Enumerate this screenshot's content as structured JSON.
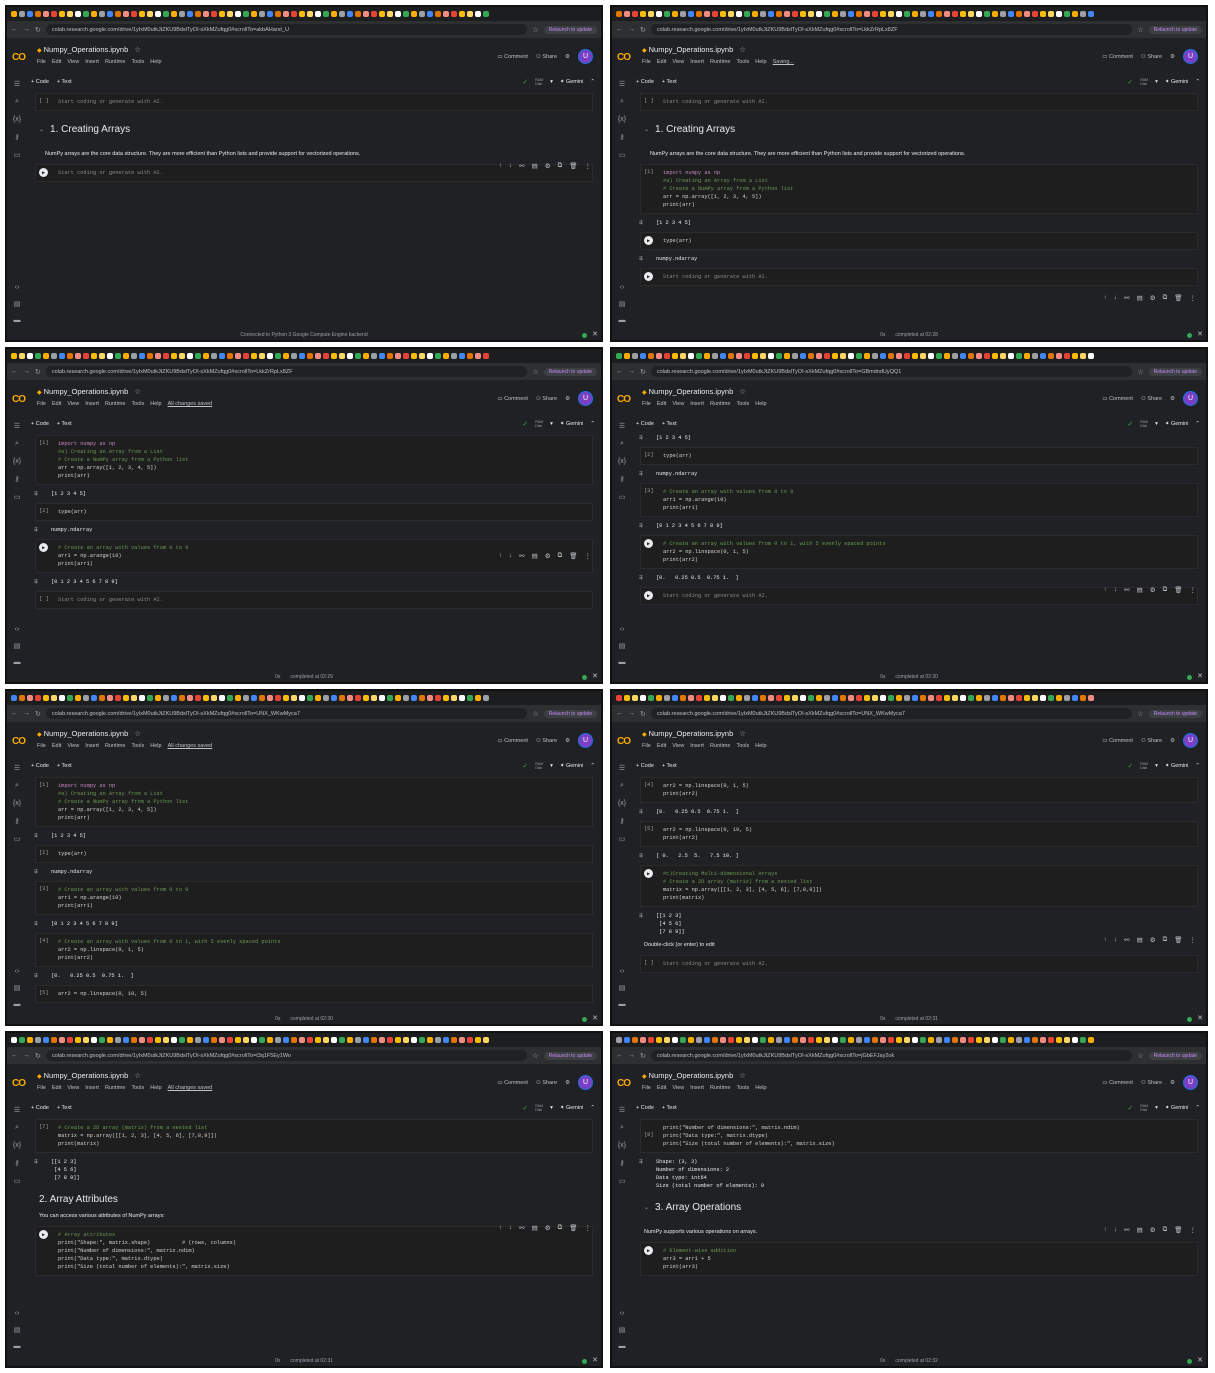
{
  "browser": {
    "relaunch": "Relaunch to update",
    "urls": [
      "colab.research.google.com/drive/1yIxM0utkJtZKU9BdslTyOI-sXkMZufqg0#scrollTo=akbAHarst_U",
      "colab.research.google.com/drive/1yIxM0utkJtZKU9BdslTyOI-sXkMZufqg0#scrollTo=LkkZrRpLx8ZF",
      "colab.research.google.com/drive/1yIxM0utkJtZKU9BdslTyOI-sXkMZufqg0#scrollTo=LkkZrRpLx8ZF",
      "colab.research.google.com/drive/1yIxM0utkJtZKU9BdslTyOI-sXkMZufqg0#scrollTo=GBmdndUyQQ1",
      "colab.research.google.com/drive/1yIxM0utkJtZKU9BdslTyOI-sXkMZufqg0#scrollTo=UNX_WKwMyca7",
      "colab.research.google.com/drive/1yIxM0utkJtZKU9BdslTyOI-sXkMZufqg0#scrollTo=UNX_WKwMyca7",
      "colab.research.google.com/drive/1yIxM0utkJtZKU9BdslTyOI-sXkMZufqg0#scrollTo=t3q1F5Ey1Wo",
      "colab.research.google.com/drive/1yIxM0utkJtZKU9BdslTyOI-sXkMZufqg0#scrollTo=jGbEFJay2ok"
    ]
  },
  "notebook": {
    "title": "Numpy_Operations.ipynb",
    "menu": [
      "File",
      "Edit",
      "View",
      "Insert",
      "Runtime",
      "Tools",
      "Help"
    ],
    "saving": "Saving...",
    "all_saved": "All changes saved",
    "comment": "Comment",
    "share": "Share",
    "avatar": "U",
    "add_code": "+ Code",
    "add_text": "+ Text",
    "ram": "RAM",
    "disk": "Disk",
    "gemini": "✦ Gemini",
    "placeholder": "Start coding or generate with AI."
  },
  "panel1": {
    "heading": "1. Creating Arrays",
    "bullet": "NumPy arrays are the core data structure. They are more efficient than Python lists and provide support for vectorized operations.",
    "status": "Connected to Python 3 Google Compute Engine backend"
  },
  "panel2": {
    "heading": "1. Creating Arrays",
    "bullet": "NumPy arrays are the core data structure. They are more efficient than Python lists and provide support for vectorized operations.",
    "c1_prompt": "[1]",
    "c1_l1": "import numpy as np",
    "c1_l2": "#a) Creating an Array from a List",
    "c1_l3": "# Create a NumPy array from a Python list",
    "c1_l4": "arr = np.array([1, 2, 3, 4, 5])",
    "c1_l5": "print(arr)",
    "o1": "[1 2 3 4 5]",
    "c2_l1": "type(arr)",
    "o2": "numpy.ndarray",
    "status_time": "0s",
    "status": "completed at 02:28"
  },
  "panel3": {
    "c1_prompt": "[1]",
    "c1_l1": "import numpy as np",
    "c1_l2": "#a) Creating an Array from a List",
    "c1_l3": "# Create a NumPy array from a Python list",
    "c1_l4": "arr = np.array([1, 2, 3, 4, 5])",
    "c1_l5": "print(arr)",
    "o1": "[1 2 3 4 5]",
    "c2_prompt": "[2]",
    "c2_l1": "type(arr)",
    "o2": "numpy.ndarray",
    "c3_l1": "# Create an array with values from 0 to 9",
    "c3_l2": "arr1 = np.arange(10)",
    "c3_l3": "print(arr1)",
    "o3": "[0 1 2 3 4 5 6 7 8 9]",
    "status_time": "0s",
    "status": "completed at 02:29"
  },
  "panel4": {
    "o1": "[1 2 3 4 5]",
    "c2_prompt": "[2]",
    "c2_l1": "type(arr)",
    "o2": "numpy.ndarray",
    "c3_prompt": "[3]",
    "c3_l1": "# Create an array with values from 0 to 9",
    "c3_l2": "arr1 = np.arange(10)",
    "c3_l3": "print(arr1)",
    "o3": "[0 1 2 3 4 5 6 7 8 9]",
    "c4_l1": "# Create an array with values from 0 to 1, with 5 evenly spaced points",
    "c4_l2": "arr2 = np.linspace(0, 1, 5)",
    "c4_l3": "print(arr2)",
    "o4": "[0.   0.25 0.5  0.75 1.  ]",
    "status_time": "0s",
    "status": "completed at 02:30"
  },
  "panel5": {
    "c1_prompt": "[1]",
    "c1_l1": "import numpy as np",
    "c1_l2": "#a) Creating an Array from a List",
    "c1_l3": "# Create a NumPy array from a Python list",
    "c1_l4": "arr = np.array([1, 2, 3, 4, 5])",
    "c1_l5": "print(arr)",
    "o1": "[1 2 3 4 5]",
    "c2_prompt": "[2]",
    "c2_l1": "type(arr)",
    "o2": "numpy.ndarray",
    "c3_prompt": "[3]",
    "c3_l1": "# Create an array with values from 0 to 9",
    "c3_l2": "arr1 = np.arange(10)",
    "c3_l3": "print(arr1)",
    "o3": "[0 1 2 3 4 5 6 7 8 9]",
    "c4_prompt": "[4]",
    "c4_l1": "# Create an array with values from 0 to 1, with 5 evenly spaced points",
    "c4_l2": "arr2 = np.linspace(0, 1, 5)",
    "c4_l3": "print(arr2)",
    "o4": "[0.   0.25 0.5  0.75 1.  ]",
    "c5_prompt": "[5]",
    "c5_l1": "arr2 = np.linspace(0, 10, 5)",
    "status_time": "0s",
    "status": "completed at 02:30"
  },
  "panel6": {
    "c4_prompt": "[4]",
    "c4_l1": "arr2 = np.linspace(0, 1, 5)",
    "c4_l2": "print(arr2)",
    "o4": "[0.   0.25 0.5  0.75 1.  ]",
    "c5_prompt": "[5]",
    "c5_l1": "arr2 = np.linspace(0, 10, 5)",
    "c5_l2": "print(arr2)",
    "o5": "[ 0.   2.5  5.   7.5 10. ]",
    "c6_l1": "#c)Creating Multi-dimensional Arrays",
    "c6_l2": "# Create a 2D array (matrix) from a nested list",
    "c6_l3": "matrix = np.array([[1, 2, 3], [4, 5, 6], [7,8,9]])",
    "c6_l4": "print(matrix)",
    "o6": "[[1 2 3]\n [4 5 6]\n [7 8 9]]",
    "dbl": "Double-click (or enter) to edit",
    "status_time": "0s",
    "status": "completed at 02:31"
  },
  "panel7": {
    "c7_prompt": "[7]",
    "c7_l1": "# Create a 2D array (matrix) from a nested list",
    "c7_l2": "matrix = np.array([[1, 2, 3], [4, 5, 6], [7,8,9]])",
    "c7_l3": "print(matrix)",
    "o7": "[[1 2 3]\n [4 5 6]\n [7 8 9]]",
    "heading": "2. Array Attributes",
    "desc": "You can access various attributes of NumPy arrays:",
    "c8_l1": "# Array attributes",
    "c8_l2": "print(\"Shape:\", matrix.shape)          # (rows, columns)",
    "c8_l3": "print(\"Number of dimensions:\", matrix.ndim)",
    "c8_l4": "print(\"Data type:\", matrix.dtype)",
    "c8_l5": "print(\"Size (total number of elements):\", matrix.size)",
    "status_time": "0s",
    "status": "completed at 02:31"
  },
  "panel8": {
    "c8_top": "print(\"Number of dimensions:\", matrix.ndim)",
    "c8_prompt": "[8]",
    "c8_l1": "print(\"Data type:\", matrix.dtype)",
    "c8_l2": "print(\"Size (total number of elements):\", matrix.size)",
    "o8": "Shape: (3, 3)\nNumber of dimensions: 2\nData type: int64\nSize (total number of elements): 9",
    "heading": "3. Array Operations",
    "desc": "NumPy supports various operations on arrays.",
    "c9_l1": "# Element-wise addition",
    "c9_l2": "arr3 = arr1 + 5",
    "c9_l3": "print(arr3)",
    "status_time": "0s",
    "status": "completed at 02:32"
  }
}
